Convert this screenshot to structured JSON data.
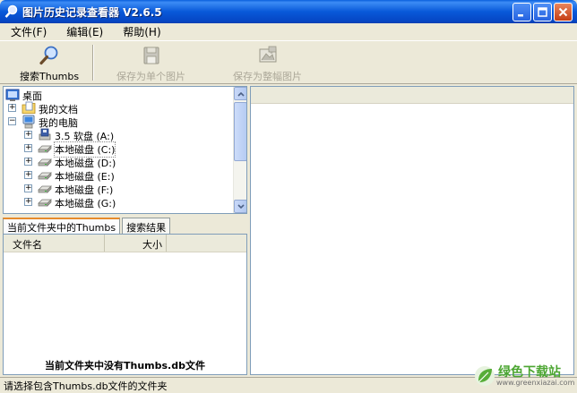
{
  "window": {
    "title": "图片历史记录查看器 V2.6.5"
  },
  "menu": {
    "items": [
      "文件(F)",
      "编辑(E)",
      "帮助(H)"
    ]
  },
  "toolbar": {
    "search_label": "搜索Thumbs",
    "save_single_label": "保存为单个图片",
    "save_whole_label": "保存为整幅图片"
  },
  "tree": {
    "items": [
      {
        "label": "桌面",
        "icon": "desktop-icon"
      },
      {
        "label": "我的文档",
        "icon": "my-documents-icon"
      },
      {
        "label": "我的电脑",
        "icon": "my-computer-icon"
      },
      {
        "label": "3.5 软盘 (A:)",
        "icon": "floppy-drive-icon"
      },
      {
        "label": "本地磁盘 (C:)",
        "icon": "hard-drive-icon"
      },
      {
        "label": "本地磁盘 (D:)",
        "icon": "hard-drive-icon"
      },
      {
        "label": "本地磁盘 (E:)",
        "icon": "hard-drive-icon"
      },
      {
        "label": "本地磁盘 (F:)",
        "icon": "hard-drive-icon"
      },
      {
        "label": "本地磁盘 (G:)",
        "icon": "hard-drive-icon"
      }
    ]
  },
  "tabs": {
    "current": "当前文件夹中的Thumbs",
    "results": "搜索结果"
  },
  "list": {
    "columns": [
      "文件名",
      "大小"
    ],
    "empty_message": "当前文件夹中没有Thumbs.db文件"
  },
  "status": {
    "text": "请选择包含Thumbs.db文件的文件夹"
  },
  "watermark": {
    "name": "绿色下载站",
    "url": "www.greenxiazai.com"
  },
  "colors": {
    "titlebar": "#0859d9",
    "watermark_green": "#4ca632"
  }
}
